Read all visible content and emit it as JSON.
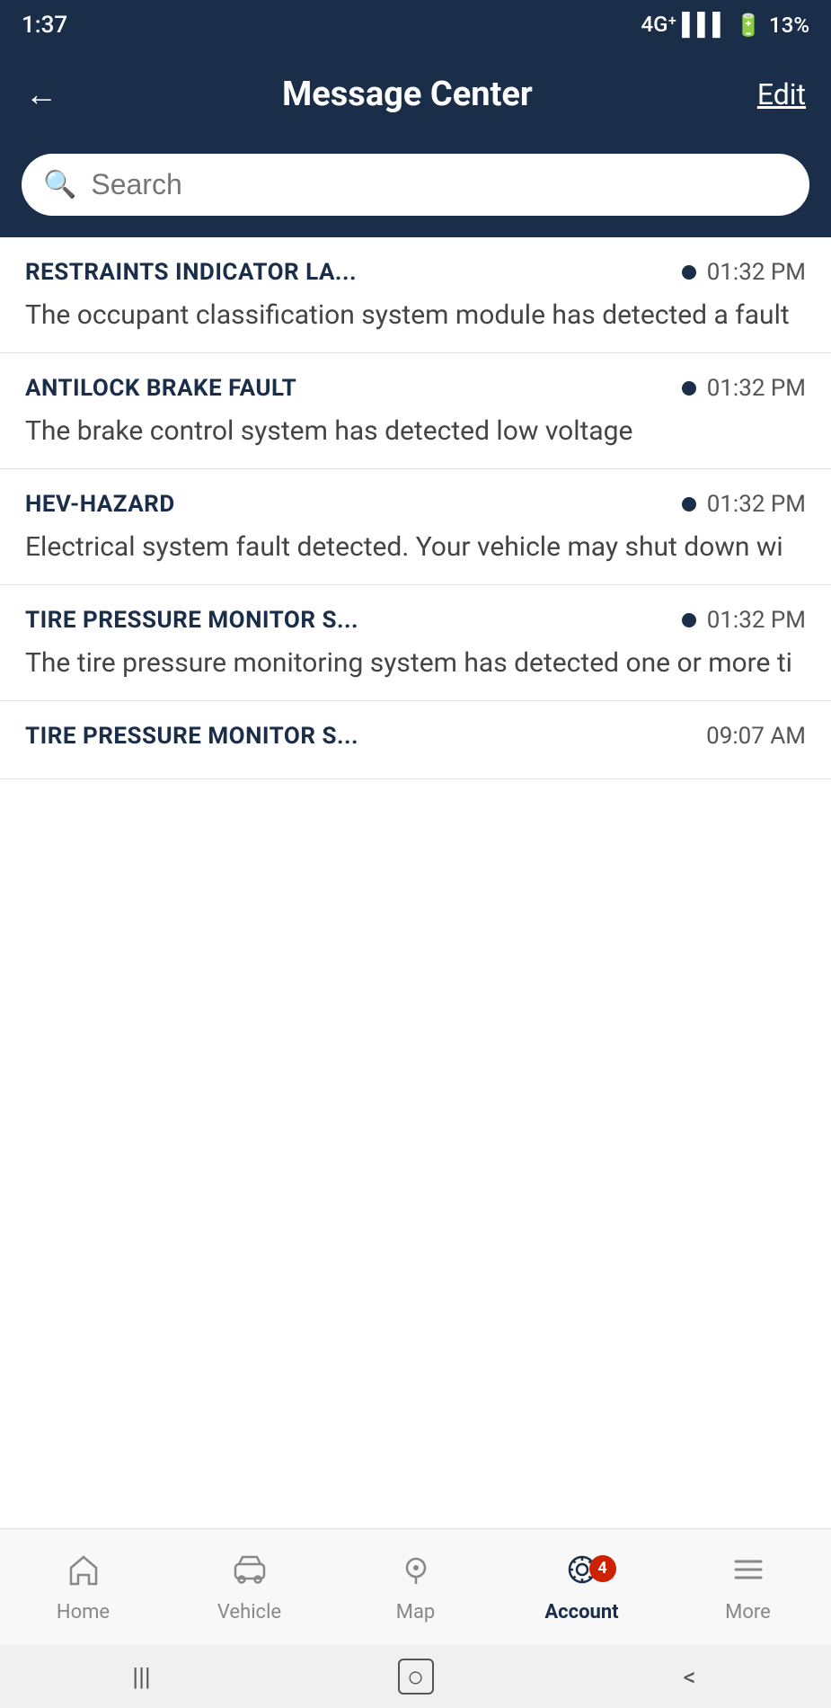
{
  "statusBar": {
    "time": "1:37",
    "signal": "4G",
    "battery": "13%"
  },
  "header": {
    "backLabel": "←",
    "title": "Message Center",
    "editLabel": "Edit"
  },
  "search": {
    "placeholder": "Search"
  },
  "messages": [
    {
      "id": 1,
      "title": "RESTRAINTS INDICATOR LA...",
      "time": "01:32 PM",
      "unread": true,
      "body": "The occupant classification system module has detected a fault"
    },
    {
      "id": 2,
      "title": "ANTILOCK BRAKE FAULT",
      "time": "01:32 PM",
      "unread": true,
      "body": "The brake control system has detected  low voltage"
    },
    {
      "id": 3,
      "title": "HEV-HAZARD",
      "time": "01:32 PM",
      "unread": true,
      "body": "Electrical system fault detected. Your vehicle may shut down wi"
    },
    {
      "id": 4,
      "title": "TIRE PRESSURE MONITOR S...",
      "time": "01:32 PM",
      "unread": true,
      "body": "The tire pressure monitoring system has detected one or more ti"
    },
    {
      "id": 5,
      "title": "TIRE PRESSURE MONITOR S...",
      "time": "09:07 AM",
      "unread": false,
      "body": ""
    }
  ],
  "bottomNav": {
    "items": [
      {
        "id": "home",
        "label": "Home",
        "active": false,
        "badge": null
      },
      {
        "id": "vehicle",
        "label": "Vehicle",
        "active": false,
        "badge": null
      },
      {
        "id": "map",
        "label": "Map",
        "active": false,
        "badge": null
      },
      {
        "id": "account",
        "label": "Account",
        "active": true,
        "badge": "4"
      },
      {
        "id": "more",
        "label": "More",
        "active": false,
        "badge": null
      }
    ]
  },
  "androidNav": {
    "recentsLabel": "|||",
    "homeLabel": "○",
    "backLabel": "<"
  }
}
